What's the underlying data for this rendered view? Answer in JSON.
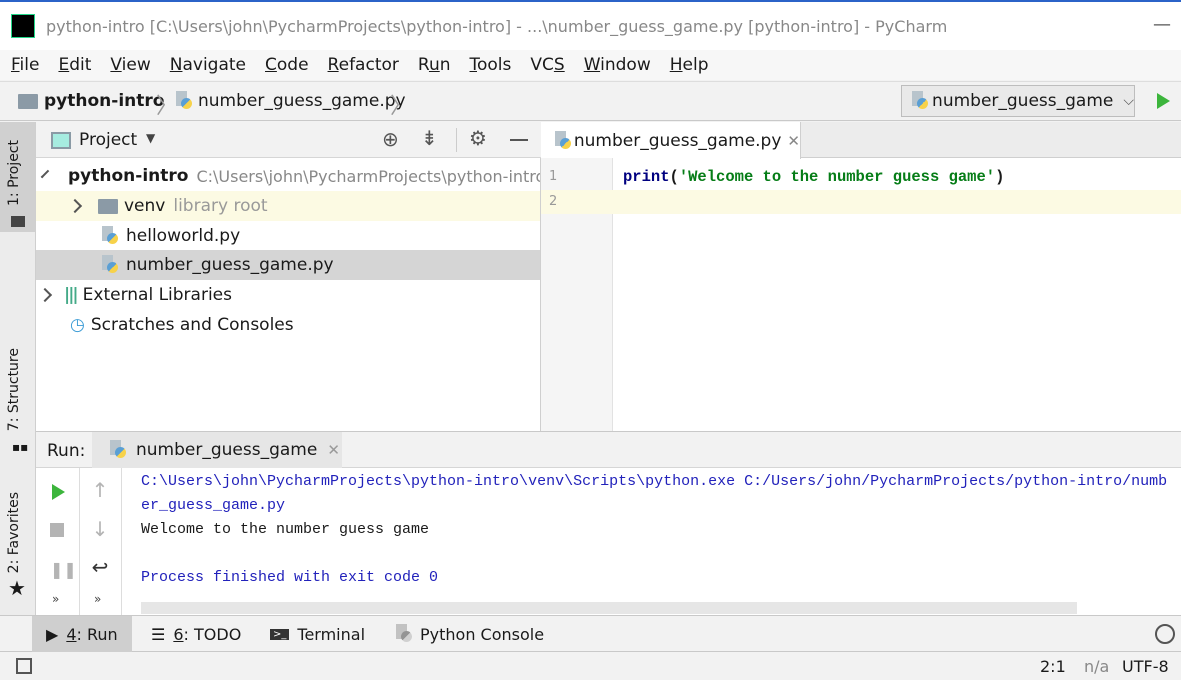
{
  "window": {
    "title": "python-intro [C:\\Users\\john\\PycharmProjects\\python-intro] - ...\\number_guess_game.py [python-intro] - PyCharm",
    "logo": "PC"
  },
  "menu": [
    {
      "u": "F",
      "rest": "ile"
    },
    {
      "u": "E",
      "rest": "dit"
    },
    {
      "u": "V",
      "rest": "iew"
    },
    {
      "u": "N",
      "rest": "avigate"
    },
    {
      "u": "C",
      "rest": "ode"
    },
    {
      "u": "R",
      "rest": "efactor"
    },
    {
      "pre": "R",
      "u": "u",
      "rest": "n"
    },
    {
      "u": "T",
      "rest": "ools"
    },
    {
      "pre": "VC",
      "u": "S",
      "rest": ""
    },
    {
      "u": "W",
      "rest": "indow"
    },
    {
      "u": "H",
      "rest": "elp"
    }
  ],
  "breadcrumb": {
    "project": "python-intro",
    "file": "number_guess_game.py"
  },
  "run_config": {
    "name": "number_guess_game"
  },
  "side_tabs": {
    "project": "1: Project",
    "structure": "7: Structure",
    "favorites": "2: Favorites"
  },
  "project_panel": {
    "title": "Project",
    "tree": {
      "root": "python-intro",
      "root_path": "C:\\Users\\john\\PycharmProjects\\python-intro",
      "venv": "venv",
      "venv_hint": "library root",
      "file1": "helloworld.py",
      "file2": "number_guess_game.py",
      "ext": "External Libraries",
      "scratch": "Scratches and Consoles"
    }
  },
  "editor": {
    "tab": "number_guess_game.py",
    "lines": [
      "1",
      "2"
    ],
    "code_fn": "print",
    "code_open": "(",
    "code_str": "'Welcome to the number guess game'",
    "code_close": ")"
  },
  "run": {
    "label": "Run:",
    "tab": "number_guess_game",
    "output": [
      "C:\\Users\\john\\PycharmProjects\\python-intro\\venv\\Scripts\\python.exe C:/Users/john/PycharmProjects/python-intro/number_guess_game.py",
      "Welcome to the number guess game",
      "Process finished with exit code 0"
    ]
  },
  "bottom_tabs": {
    "run_n": "4",
    "run": ": Run",
    "todo_n": "6",
    "todo": ": TODO",
    "terminal": "Terminal",
    "console": "Python Console"
  },
  "status": {
    "position": "2:1",
    "na": "n/a",
    "enc": "UTF-8"
  },
  "colors": {
    "accent_green": "#3cb53c",
    "string": "#067d17",
    "keyword": "#000080",
    "console_blue": "#2222bb",
    "current_line": "#fcfae3",
    "selection": "#d5d5d5"
  }
}
